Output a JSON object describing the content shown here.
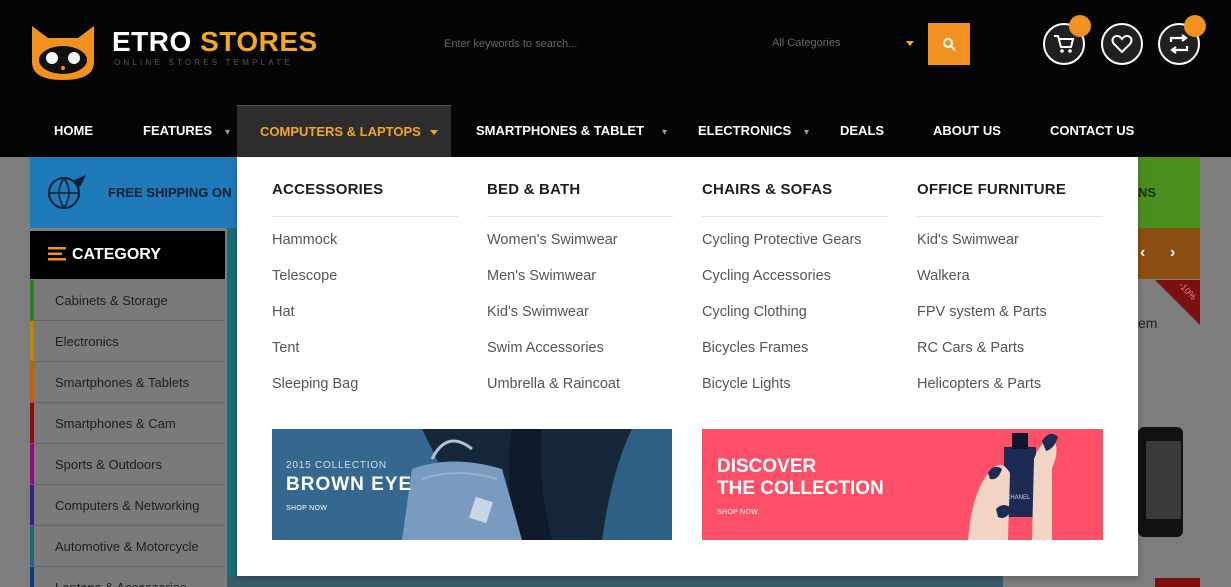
{
  "brand": {
    "name_part1": "ETRO ",
    "name_part2": "STORES",
    "tagline": "ONLINE STORES TEMPLATE",
    "accent_color": "#f5a623"
  },
  "search": {
    "placeholder": "Enter keywords to search...",
    "category_selected": "All Categories",
    "button_icon": "search-icon"
  },
  "header_icons": [
    "cart-icon",
    "heart-icon",
    "compare-icon"
  ],
  "nav": {
    "items": [
      {
        "label": "HOME"
      },
      {
        "label": "FEATURES"
      },
      {
        "label": "COMPUTERS & LAPTOPS"
      },
      {
        "label": "SMARTPHONES & TABLET"
      },
      {
        "label": "ELECTRONICS"
      },
      {
        "label": "DEALS"
      },
      {
        "label": "ABOUT US"
      },
      {
        "label": "CONTACT US"
      }
    ]
  },
  "background": {
    "shipping_text": "FREE SHIPPING ON",
    "right_banner_fragment": "NS",
    "category_title": "CATEGORY",
    "categories": [
      {
        "label": "Cabinets & Storage",
        "color": "#2d7d2d"
      },
      {
        "label": "Electronics",
        "color": "#b8860b"
      },
      {
        "label": "Smartphones & Tablets",
        "color": "#c06010"
      },
      {
        "label": "Smartphones & Cam",
        "color": "#8a1010"
      },
      {
        "label": "Sports & Outdoors",
        "color": "#8a1080"
      },
      {
        "label": "Computers & Networking",
        "color": "#3a2080"
      },
      {
        "label": "Automotive & Motorcycle",
        "color": "#1a6a7a"
      },
      {
        "label": "Laptops & Accessories",
        "color": "#103a7a"
      }
    ],
    "sale_text": "-10%",
    "item_fragment": "em",
    "arrow_prev": "‹",
    "arrow_next": "›"
  },
  "mega_menu": {
    "columns": [
      {
        "title": "ACCESSORIES",
        "links": [
          "Hammock",
          "Telescope",
          "Hat",
          "Tent",
          "Sleeping Bag"
        ]
      },
      {
        "title": "BED & BATH",
        "links": [
          "Women's Swimwear",
          "Men's Swimwear",
          "Kid's Swimwear",
          "Swim Accessories",
          "Umbrella & Raincoat"
        ]
      },
      {
        "title": "CHAIRS & SOFAS",
        "links": [
          "Cycling Protective Gears",
          "Cycling Accessories",
          "Cycling Clothing",
          "Bicycles Frames",
          "Bicycle Lights"
        ]
      },
      {
        "title": "OFFICE FURNITURE",
        "links": [
          "Kid's Swimwear",
          "Walkera",
          "FPV system & Parts",
          "RC Cars & Parts",
          "Helicopters & Parts"
        ]
      }
    ],
    "banner1": {
      "subtitle": "2015 COLLECTION",
      "title": "BROWN EYE",
      "cta": "SHOP NOW"
    },
    "banner2": {
      "title_line1": "DISCOVER",
      "title_line2": "THE COLLECTION",
      "cta": "SHOP NOW",
      "bottle_label": "CHANEL"
    }
  }
}
